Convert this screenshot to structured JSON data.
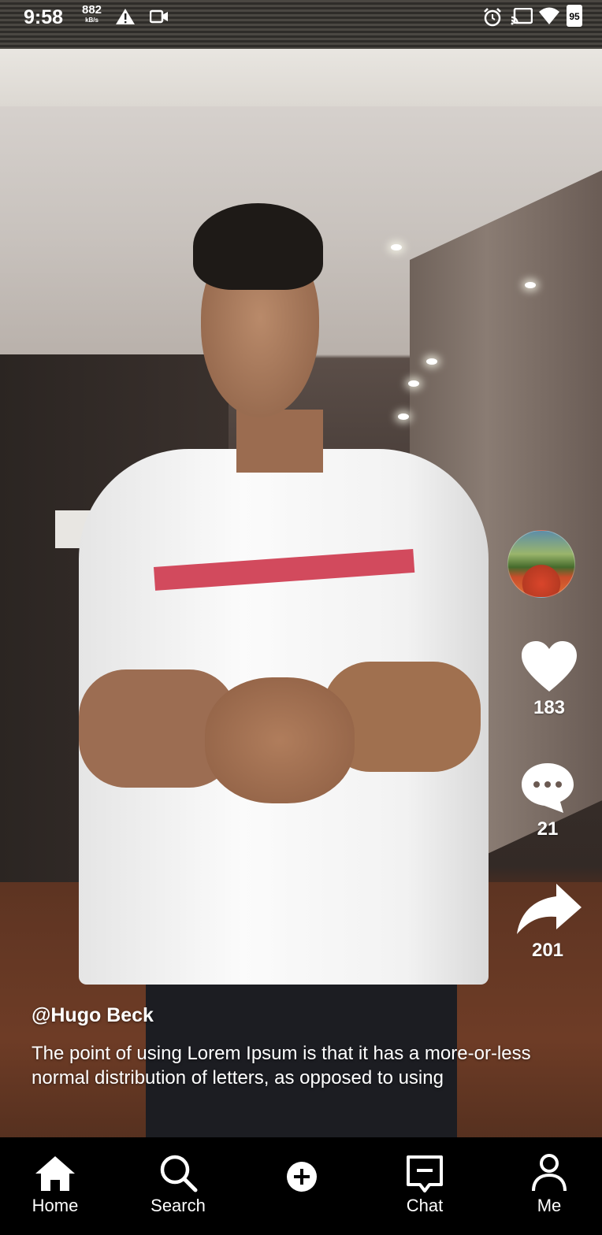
{
  "status_bar": {
    "time": "9:58",
    "net_speed": "882",
    "net_unit": "kB/s",
    "battery": "95",
    "icons": [
      "warning-icon",
      "video-record-icon",
      "alarm-icon",
      "cast-icon",
      "wifi-icon",
      "battery-icon"
    ]
  },
  "video": {
    "author": "@Hugo Beck",
    "description": "The point of using Lorem Ipsum is that it has a more-or-less normal distribution of letters, as opposed to using",
    "likes": "183",
    "comments": "21",
    "shares": "201"
  },
  "nav": {
    "items": [
      {
        "label": "Home",
        "icon": "home-icon"
      },
      {
        "label": "Search",
        "icon": "search-icon"
      },
      {
        "label": "",
        "icon": "add-icon"
      },
      {
        "label": "Chat",
        "icon": "chat-icon"
      },
      {
        "label": "Me",
        "icon": "person-icon"
      }
    ]
  },
  "colors": {
    "accent": "#ffffff",
    "nav_bg": "#000000"
  }
}
